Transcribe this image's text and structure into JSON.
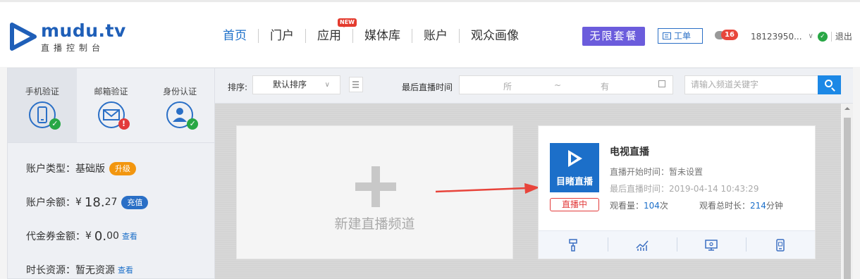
{
  "brand": {
    "name": "mudu.tv",
    "subtitle": "直播控制台",
    "color": "#1f5fb8"
  },
  "nav": {
    "items": [
      {
        "label": "首页",
        "active": true
      },
      {
        "label": "门户"
      },
      {
        "label": "应用",
        "badge": "NEW"
      },
      {
        "label": "媒体库"
      },
      {
        "label": "账户"
      },
      {
        "label": "观众画像"
      }
    ]
  },
  "header": {
    "promo_label": "无限套餐",
    "ticket_label": "工单",
    "message_count": "16",
    "username": "18123950...",
    "logout_label": "退出"
  },
  "sidebar": {
    "verifications": [
      {
        "label": "手机验证",
        "icon": "phone-icon",
        "status": "verified"
      },
      {
        "label": "邮箱验证",
        "icon": "mail-icon",
        "status": "unverified"
      },
      {
        "label": "身份认证",
        "icon": "user-icon",
        "status": "verified"
      }
    ],
    "account_type_label": "账户类型：",
    "account_type_value": "基础版",
    "upgrade_label": "升级",
    "balance_label": "账户余额：",
    "balance_currency": "¥",
    "balance_int": "18.",
    "balance_dec": "27",
    "recharge_label": "充值",
    "voucher_label": "代金券金额：",
    "voucher_currency": "¥",
    "voucher_int": "0.",
    "voucher_dec": "00",
    "voucher_view": "查看",
    "duration_label": "时长资源：",
    "duration_value": "暂无资源",
    "duration_view": "查看"
  },
  "filters": {
    "sort_label": "排序:",
    "sort_value": "默认排序",
    "last_live_label": "最后直播时间",
    "date_from": "所",
    "date_sep": "~",
    "date_to": "有",
    "search_placeholder": "请输入频道关键字"
  },
  "new_channel": {
    "label": "新建直播频道"
  },
  "channel": {
    "title": "电视直播",
    "thumb_label": "目睹直播",
    "status": "直播中",
    "start_time": "直播开始时间：暂未设置",
    "last_live": "最后直播时间：2019-04-14 10:43:29",
    "views_label": "观看量：",
    "views_value": "104",
    "views_unit": "次",
    "total_duration_label": "观看总时长：",
    "total_duration_value": "214",
    "total_duration_unit": "分钟",
    "tools": [
      "brush-icon",
      "chart-icon",
      "monitor-icon",
      "mobile-icon"
    ]
  },
  "colors": {
    "accent": "#1c6fc9",
    "promo": "#6b5cdc",
    "live": "#e23b3b",
    "upgrade": "#f2960f"
  }
}
